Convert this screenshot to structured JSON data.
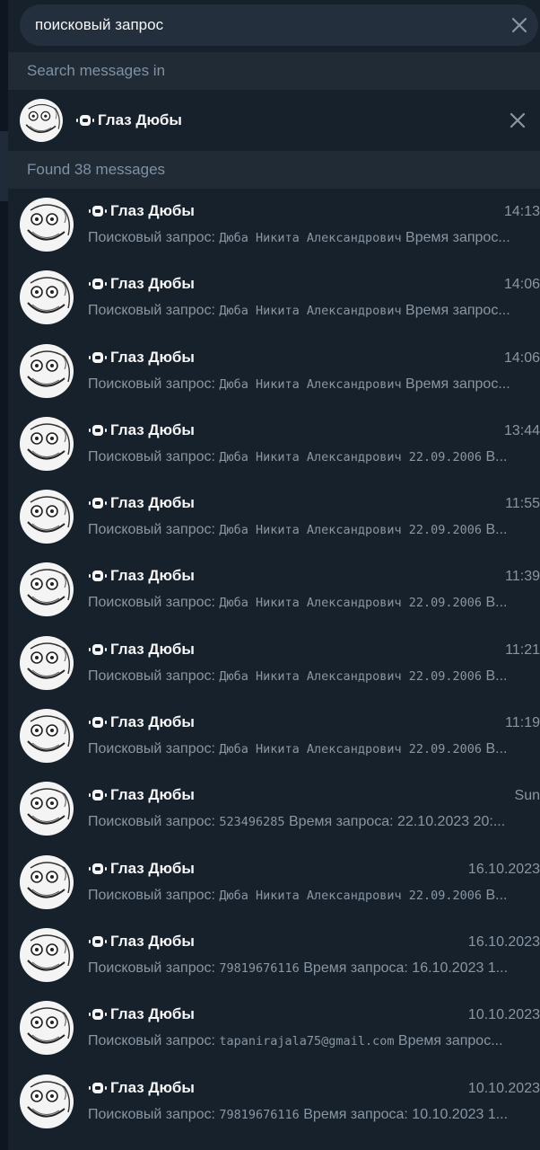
{
  "search": {
    "value": "поисковый запрос",
    "clear_icon": "close-icon"
  },
  "search_in": {
    "header": "Search messages in",
    "chat_name": "Глаз Дюбы",
    "clear_icon": "close-icon"
  },
  "found": {
    "header": "Found 38 messages"
  },
  "results": [
    {
      "chat": "Глаз Дюбы",
      "time": "14:13",
      "prefix": "Поисковый запрос: ",
      "query": "Дюба Никита Александрович",
      "suffix": " Время запрос..."
    },
    {
      "chat": "Глаз Дюбы",
      "time": "14:06",
      "prefix": "Поисковый запрос: ",
      "query": "Дюба Никита Александрович",
      "suffix": " Время запрос..."
    },
    {
      "chat": "Глаз Дюбы",
      "time": "14:06",
      "prefix": "Поисковый запрос: ",
      "query": "Дюба Никита Александрович",
      "suffix": " Время запрос..."
    },
    {
      "chat": "Глаз Дюбы",
      "time": "13:44",
      "prefix": "Поисковый запрос: ",
      "query": "Дюба Никита Александрович 22.09.2006",
      "suffix": " В..."
    },
    {
      "chat": "Глаз Дюбы",
      "time": "11:55",
      "prefix": "Поисковый запрос: ",
      "query": "Дюба Никита Александрович 22.09.2006",
      "suffix": " В..."
    },
    {
      "chat": "Глаз Дюбы",
      "time": "11:39",
      "prefix": "Поисковый запрос: ",
      "query": "Дюба Никита Александрович 22.09.2006",
      "suffix": " В..."
    },
    {
      "chat": "Глаз Дюбы",
      "time": "11:21",
      "prefix": "Поисковый запрос: ",
      "query": "Дюба Никита Александрович 22.09.2006",
      "suffix": " В..."
    },
    {
      "chat": "Глаз Дюбы",
      "time": "11:19",
      "prefix": "Поисковый запрос: ",
      "query": "Дюба Никита Александрович 22.09.2006",
      "suffix": " В..."
    },
    {
      "chat": "Глаз Дюбы",
      "time": "Sun",
      "prefix": "Поисковый запрос: ",
      "query": "523496285",
      "suffix": " Время запроса: 22.10.2023 20:..."
    },
    {
      "chat": "Глаз Дюбы",
      "time": "16.10.2023",
      "prefix": "Поисковый запрос: ",
      "query": "Дюба Никита Александрович 22.09.2006",
      "suffix": " В..."
    },
    {
      "chat": "Глаз Дюбы",
      "time": "16.10.2023",
      "prefix": "Поисковый запрос: ",
      "query": "79819676116",
      "suffix": " Время запроса: 16.10.2023 1..."
    },
    {
      "chat": "Глаз Дюбы",
      "time": "10.10.2023",
      "prefix": "Поисковый запрос: ",
      "query": "tapanirajala75@gmail.com",
      "suffix": " Время запрос..."
    },
    {
      "chat": "Глаз Дюбы",
      "time": "10.10.2023",
      "prefix": "Поисковый запрос: ",
      "query": "79819676116",
      "suffix": " Время запроса: 10.10.2023 1..."
    }
  ],
  "icons": {
    "bot": "bot-icon",
    "avatar": "troll-face-avatar"
  },
  "colors": {
    "background": "#17212b",
    "search_box": "#242f3d",
    "section_header": "#202b36",
    "secondary_text": "#8896a4",
    "header_text": "#7f91a4"
  }
}
